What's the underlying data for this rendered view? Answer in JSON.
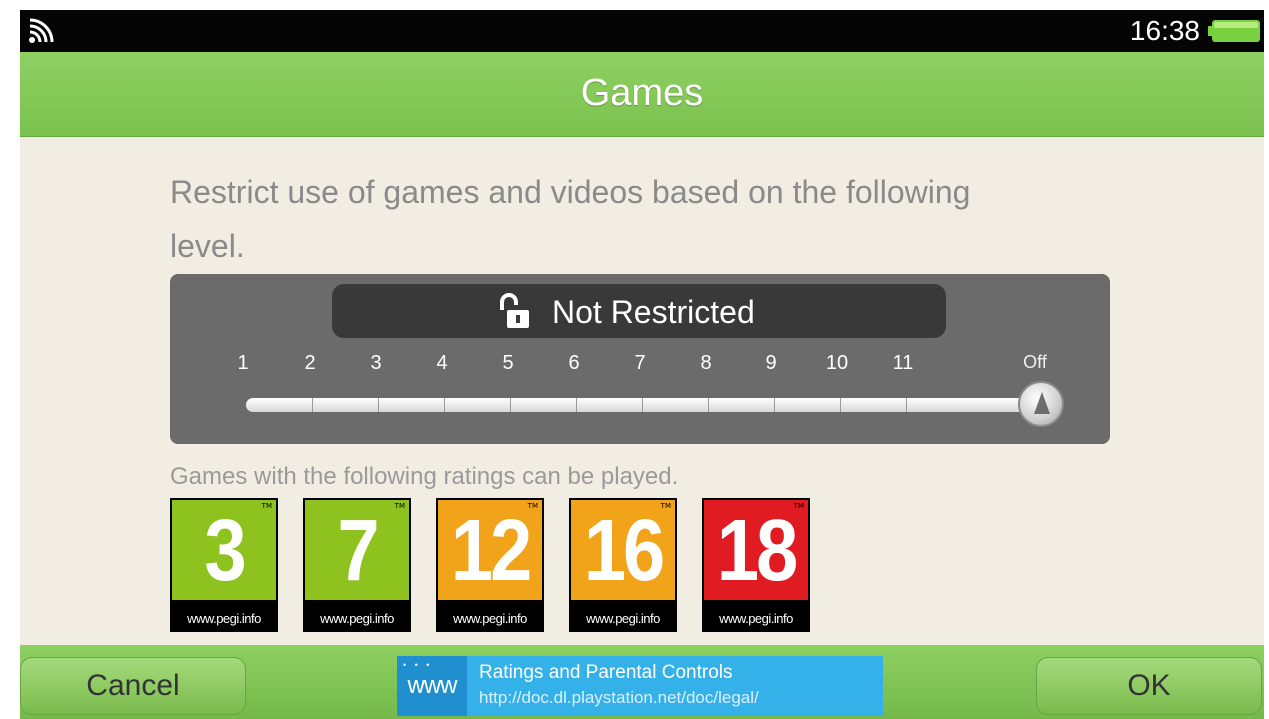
{
  "statusbar": {
    "time": "16:38",
    "signal_icon": "wifi-icon",
    "battery_icon": "battery-icon",
    "battery_color": "#7ad13f"
  },
  "header": {
    "title": "Games"
  },
  "main": {
    "description": "Restrict use of games and videos based on the following level.",
    "slider": {
      "status_icon": "unlock-icon",
      "status_text": "Not Restricted",
      "ticks": [
        "1",
        "2",
        "3",
        "4",
        "5",
        "6",
        "7",
        "8",
        "9",
        "10",
        "11",
        "Off"
      ],
      "selected": "Off"
    },
    "ratings_caption": "Games with the following ratings can be played.",
    "ratings": [
      {
        "label": "3",
        "footer": "www.pegi.info",
        "color": "#8dc21f"
      },
      {
        "label": "7",
        "footer": "www.pegi.info",
        "color": "#8dc21f"
      },
      {
        "label": "12",
        "footer": "www.pegi.info",
        "color": "#f1a31a"
      },
      {
        "label": "16",
        "footer": "www.pegi.info",
        "color": "#f1a31a"
      },
      {
        "label": "18",
        "footer": "www.pegi.info",
        "color": "#e11b22"
      }
    ]
  },
  "footer": {
    "cancel_label": "Cancel",
    "ok_label": "OK",
    "link": {
      "icon_text": "www",
      "title": "Ratings and Parental Controls",
      "url": "http://doc.dl.playstation.net/doc/legal/"
    }
  },
  "colors": {
    "accent_green": "#7bc24f",
    "background": "#f1ede3",
    "slider_panel": "#6b6b6b",
    "link_banner": "#34b1e8"
  }
}
